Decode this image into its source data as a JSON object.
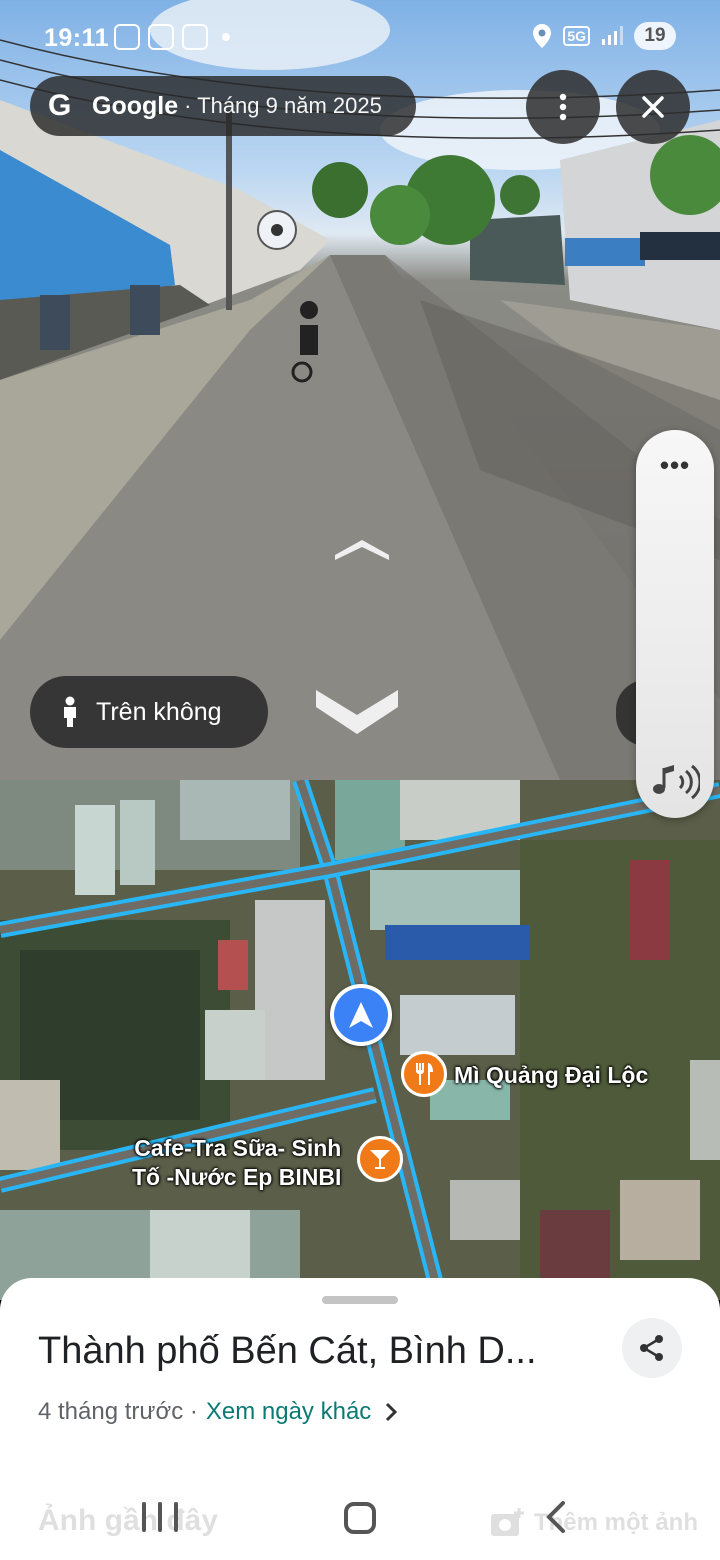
{
  "status_bar": {
    "time": "19:11",
    "network": "5G",
    "battery": "19"
  },
  "header": {
    "brand": "Google",
    "capture_date": "· Tháng 9 năm 2025"
  },
  "street_view": {
    "aerial_button_label": "Trên không",
    "audio_panel_dots": "•••"
  },
  "map": {
    "pois": [
      {
        "name": "Mì Quảng Đại Lộc",
        "icon": "restaurant-icon"
      },
      {
        "name": "Cafe-Tra Sữa- Sinh\nTố -Nước Ep BINBI",
        "icon": "cafe-icon"
      }
    ]
  },
  "sheet": {
    "title": "Thành phố Bến Cát, Bình D...",
    "meta": "4 tháng trước ·",
    "link": "Xem ngày khác",
    "recent_label": "Ảnh gần đây",
    "add_photo_label": "Thêm một ảnh"
  },
  "colors": {
    "accent_teal": "#0b7a75",
    "poi_orange": "#f07a17",
    "nav_blue": "#3b82f6",
    "road_highlight": "#29b6f6"
  }
}
